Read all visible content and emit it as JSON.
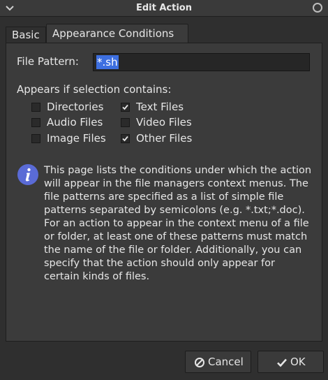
{
  "window": {
    "title": "Edit Action"
  },
  "tabs": [
    {
      "label": "Basic"
    },
    {
      "label": "Appearance Conditions"
    }
  ],
  "file_pattern": {
    "label": "File Pattern:",
    "value": "*.sh"
  },
  "appears_label": "Appears if selection contains:",
  "checkboxes": [
    {
      "label": "Directories",
      "checked": false
    },
    {
      "label": "Text Files",
      "checked": true
    },
    {
      "label": "Audio Files",
      "checked": false
    },
    {
      "label": "Video Files",
      "checked": false
    },
    {
      "label": "Image Files",
      "checked": false
    },
    {
      "label": "Other Files",
      "checked": true
    }
  ],
  "info": {
    "icon": "info-icon",
    "text": "This page lists the conditions under which the action will appear in the file managers context menus. The file patterns are specified as a list of simple file patterns separated by semicolons (e.g. *.txt;*.doc). For an action to appear in the context menu of a file or folder, at least one of these patterns must match the name of the file or folder. Additionally, you can specify that the action should only appear for certain kinds of files."
  },
  "buttons": {
    "cancel": {
      "label": "Cancel",
      "icon": "cancel-icon"
    },
    "ok": {
      "label": "OK",
      "icon": "check-icon"
    }
  },
  "colors": {
    "selection": "#3d6fe0",
    "info_icon": "#5a6bd6"
  }
}
